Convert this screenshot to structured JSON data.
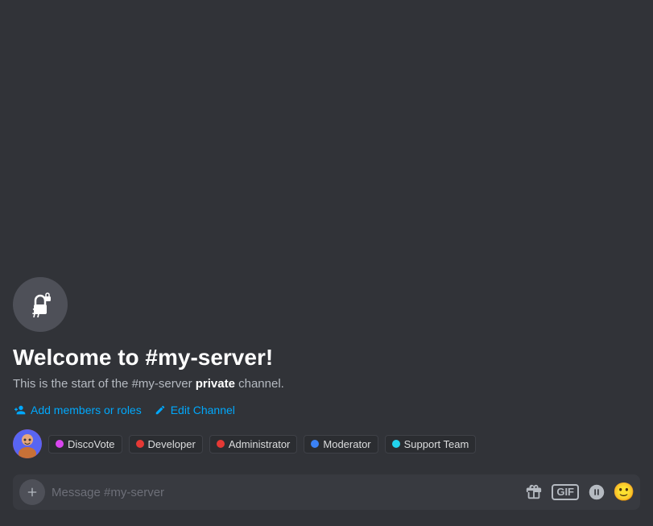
{
  "channel": {
    "name": "#my-server",
    "icon_label": "#🔒"
  },
  "welcome": {
    "title": "Welcome to #my-server!",
    "description_prefix": "This is the start of the ",
    "description_channel": "#my-server",
    "description_suffix": " private channel.",
    "description_bold": "private"
  },
  "actions": {
    "add_members": "Add members or roles",
    "edit_channel": "Edit Channel"
  },
  "roles": [
    {
      "name": "DiscoVote",
      "color": "#d946ef"
    },
    {
      "name": "Developer",
      "color": "#e53935"
    },
    {
      "name": "Administrator",
      "color": "#e53935"
    },
    {
      "name": "Moderator",
      "color": "#3b82f6"
    },
    {
      "name": "Support Team",
      "color": "#22d3ee"
    }
  ],
  "message_input": {
    "placeholder": "Message #my-server"
  },
  "toolbar": {
    "gift_icon": "🎁",
    "gif_label": "GIF",
    "sticker_icon": "🎭",
    "emoji_icon": "😊"
  }
}
